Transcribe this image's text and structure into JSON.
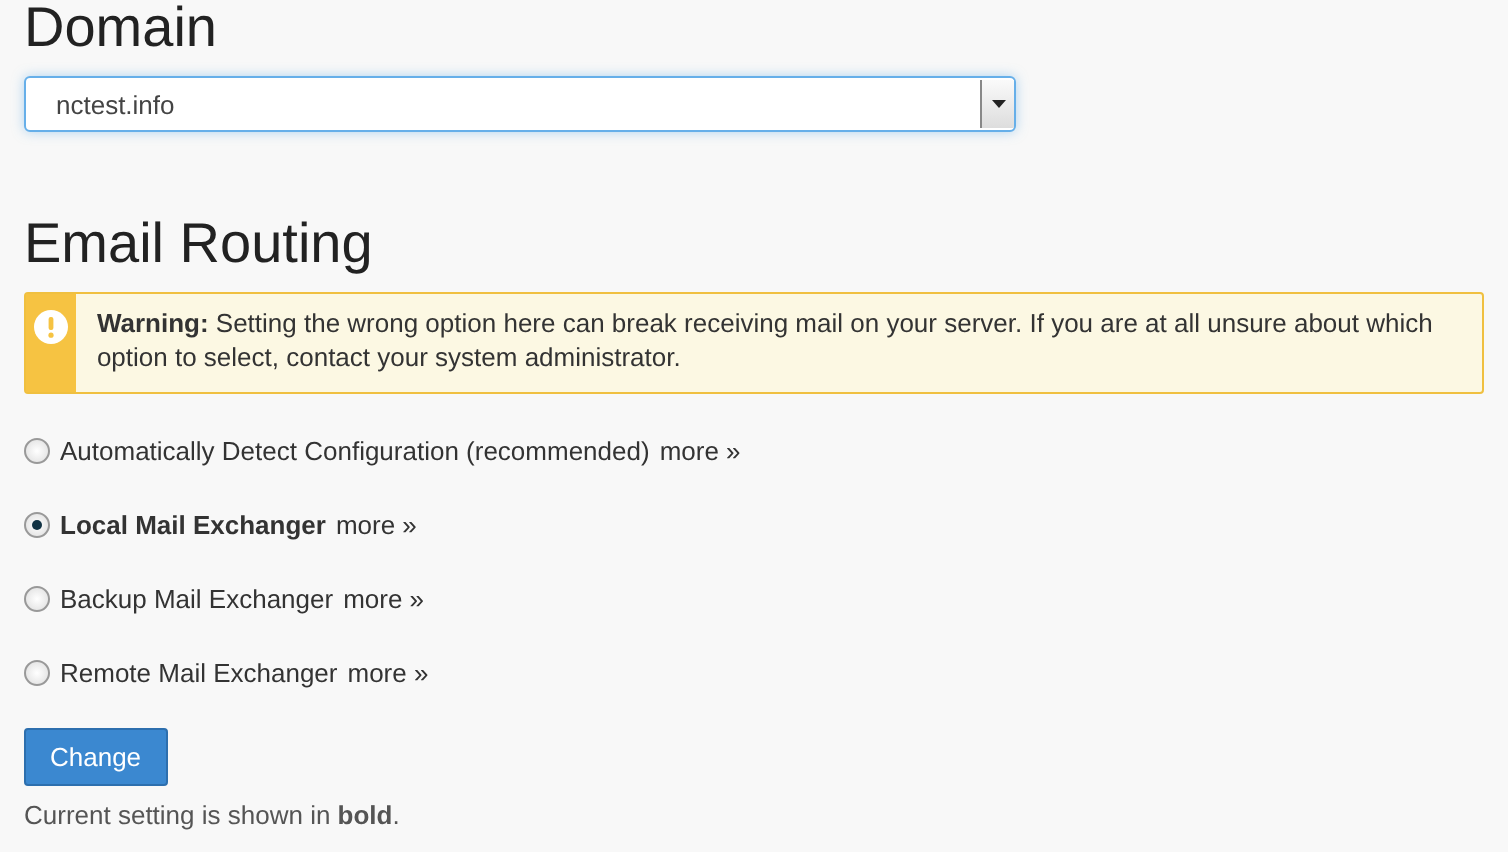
{
  "domain": {
    "heading": "Domain",
    "select": {
      "value": "nctest.info"
    }
  },
  "routing": {
    "heading": "Email Routing",
    "warning": "**Warning:** Setting the wrong option here can break receiving mail on your server. If you are at all unsure about which option to select, contact your system administrator.",
    "options": [
      {
        "label": "Automatically Detect Configuration (recommended)",
        "more": "more »",
        "selected": false
      },
      {
        "label": "Local Mail Exchanger",
        "more": "more »",
        "selected": true
      },
      {
        "label": "Backup Mail Exchanger",
        "more": "more »",
        "selected": false
      },
      {
        "label": "Remote Mail Exchanger",
        "more": "more »",
        "selected": false
      }
    ],
    "button": "Change",
    "note": "Current setting is shown in **bold**."
  }
}
